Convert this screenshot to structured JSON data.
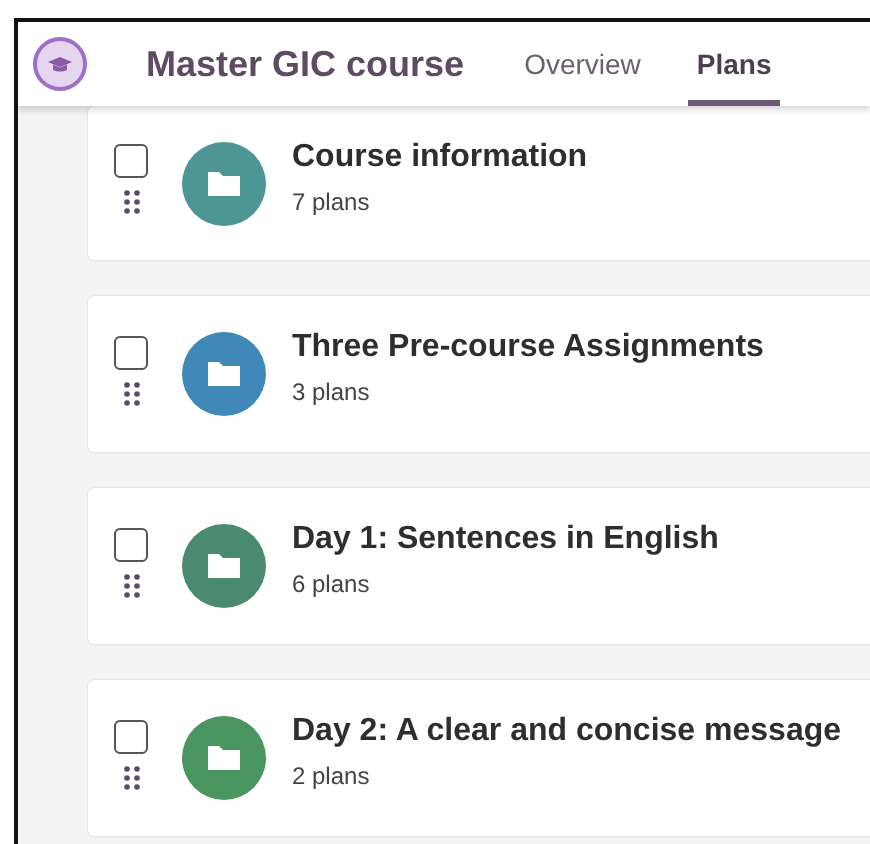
{
  "header": {
    "title": "Master GIC course",
    "tabs": [
      {
        "label": "Overview",
        "selected": false
      },
      {
        "label": "Plans",
        "selected": true
      }
    ]
  },
  "folders": [
    {
      "title": "Course information",
      "count": "7 plans",
      "checked": false,
      "color": "#4e9596"
    },
    {
      "title": "Three Pre-course Assignments",
      "count": "3 plans",
      "checked": false,
      "color": "#3f88b8"
    },
    {
      "title": "Day 1: Sentences in English",
      "count": "6 plans",
      "checked": false,
      "color": "#498a70"
    },
    {
      "title": "Day 2: A clear and concise message",
      "count": "2 plans",
      "checked": false,
      "color": "#4a9560"
    }
  ]
}
